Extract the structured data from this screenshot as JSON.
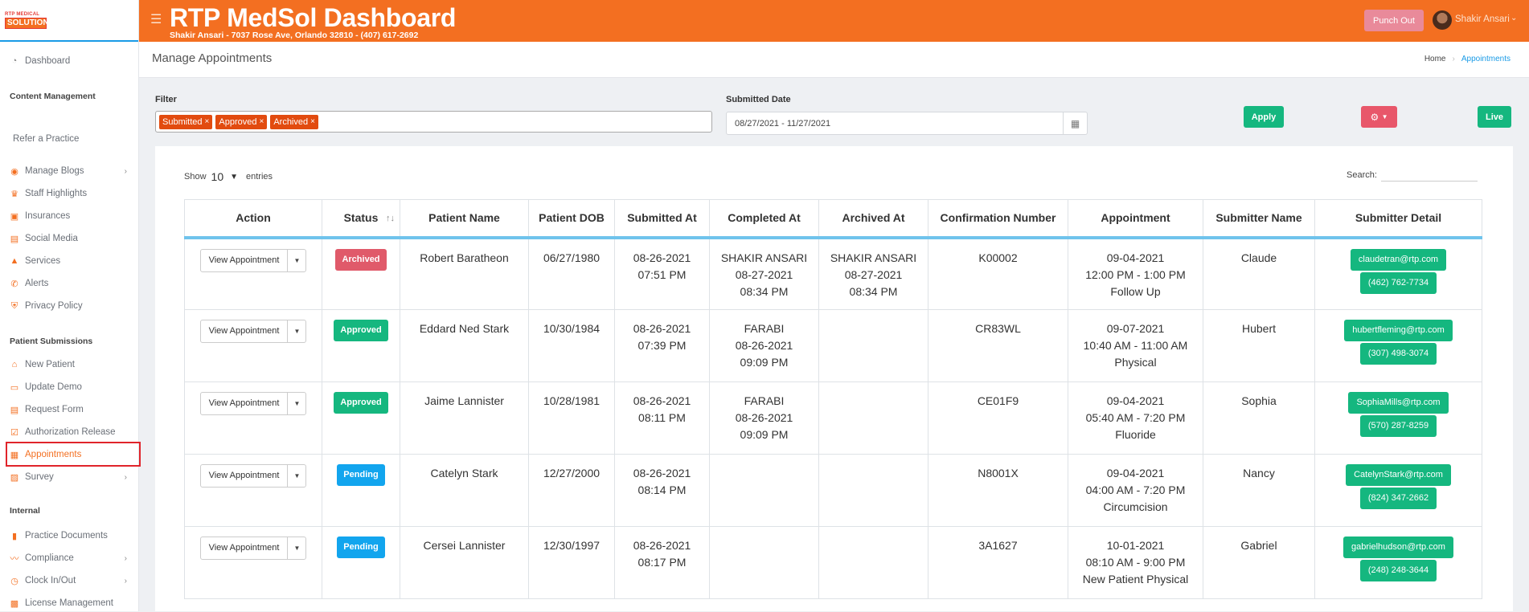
{
  "logo": {
    "line1": "RTP MEDICAL",
    "line2": "SOLUTION"
  },
  "sidebar": {
    "dashboard": "Dashboard",
    "content_management": "Content Management",
    "refer": "Refer a Practice",
    "content_items": [
      {
        "label": "Manage Blogs",
        "icon": "blog-icon",
        "chevron": true
      },
      {
        "label": "Staff Highlights",
        "icon": "award-icon",
        "chevron": false
      },
      {
        "label": "Insurances",
        "icon": "insurance-icon",
        "chevron": false
      },
      {
        "label": "Social Media",
        "icon": "social-icon",
        "chevron": false
      },
      {
        "label": "Services",
        "icon": "services-icon",
        "chevron": false
      },
      {
        "label": "Alerts",
        "icon": "phone-icon",
        "chevron": false
      },
      {
        "label": "Privacy Policy",
        "icon": "shield-icon",
        "chevron": false
      }
    ],
    "patient_submissions": "Patient Submissions",
    "patient_items": [
      {
        "label": "New Patient",
        "icon": "home-icon",
        "chevron": false
      },
      {
        "label": "Update Demo",
        "icon": "id-card-icon",
        "chevron": false
      },
      {
        "label": "Request Form",
        "icon": "form-icon",
        "chevron": false
      },
      {
        "label": "Authorization Release",
        "icon": "check-doc-icon",
        "chevron": false
      },
      {
        "label": "Appointments",
        "icon": "calendar-icon",
        "chevron": false
      },
      {
        "label": "Survey",
        "icon": "survey-icon",
        "chevron": true
      }
    ],
    "internal": "Internal",
    "internal_items": [
      {
        "label": "Practice Documents",
        "icon": "document-icon",
        "chevron": false
      },
      {
        "label": "Compliance",
        "icon": "compliance-icon",
        "chevron": true
      },
      {
        "label": "Clock In/Out",
        "icon": "clock-icon",
        "chevron": true
      },
      {
        "label": "License Management",
        "icon": "license-icon",
        "chevron": false
      }
    ]
  },
  "header": {
    "title": "RTP MedSol Dashboard",
    "subtitle": "Shakir Ansari - 7037 Rose Ave, Orlando 32810 - (407) 617-2692",
    "punch_out": "Punch Out",
    "user": "Shakir Ansari"
  },
  "page": {
    "title": "Manage Appointments",
    "breadcrumb_home": "Home",
    "breadcrumb_current": "Appointments"
  },
  "filters": {
    "filter_label": "Filter",
    "tags": [
      "Submitted",
      "Approved",
      "Archived"
    ],
    "date_label": "Submitted Date",
    "date_value": "08/27/2021 - 11/27/2021",
    "apply": "Apply",
    "live": "Live"
  },
  "table_controls": {
    "show": "Show",
    "entries_value": "10",
    "entries": "entries",
    "search": "Search:"
  },
  "table": {
    "columns": [
      "Action",
      "Status",
      "Patient Name",
      "Patient DOB",
      "Submitted At",
      "Completed At",
      "Archived At",
      "Confirmation Number",
      "Appointment",
      "Submitter Name",
      "Submitter Detail"
    ],
    "view_label": "View Appointment",
    "rows": [
      {
        "status": "Archived",
        "status_class": "b-archived",
        "name": "Robert Baratheon",
        "dob": "06/27/1980",
        "submitted": [
          "08-26-2021",
          "07:51 PM"
        ],
        "completed": [
          "SHAKIR ANSARI",
          "08-27-2021",
          "08:34 PM"
        ],
        "archived": [
          "SHAKIR ANSARI",
          "08-27-2021",
          "08:34 PM"
        ],
        "confirmation": "K00002",
        "appointment": [
          "09-04-2021",
          "12:00 PM - 1:00 PM",
          "Follow Up"
        ],
        "submitter": "Claude",
        "email": "claudetran@rtp.com",
        "phone": "(462) 762-7734"
      },
      {
        "status": "Approved",
        "status_class": "b-approved",
        "name": "Eddard Ned Stark",
        "dob": "10/30/1984",
        "submitted": [
          "08-26-2021",
          "07:39 PM"
        ],
        "completed": [
          "FARABI",
          "08-26-2021",
          "09:09 PM"
        ],
        "archived": [],
        "confirmation": "CR83WL",
        "appointment": [
          "09-07-2021",
          "10:40 AM - 11:00 AM",
          "Physical"
        ],
        "submitter": "Hubert",
        "email": "hubertfleming@rtp.com",
        "phone": "(307) 498-3074"
      },
      {
        "status": "Approved",
        "status_class": "b-approved",
        "name": "Jaime Lannister",
        "dob": "10/28/1981",
        "submitted": [
          "08-26-2021",
          "08:11 PM"
        ],
        "completed": [
          "FARABI",
          "08-26-2021",
          "09:09 PM"
        ],
        "archived": [],
        "confirmation": "CE01F9",
        "appointment": [
          "09-04-2021",
          "05:40 AM - 7:20 PM",
          "Fluoride"
        ],
        "submitter": "Sophia",
        "email": "SophiaMills@rtp.com",
        "phone": "(570) 287-8259"
      },
      {
        "status": "Pending",
        "status_class": "b-pending",
        "name": "Catelyn Stark",
        "dob": "12/27/2000",
        "submitted": [
          "08-26-2021",
          "08:14 PM"
        ],
        "completed": [],
        "archived": [],
        "confirmation": "N8001X",
        "appointment": [
          "09-04-2021",
          "04:00 AM - 7:20 PM",
          "Circumcision"
        ],
        "submitter": "Nancy",
        "email": "CatelynStark@rtp.com",
        "phone": "(824) 347-2662"
      },
      {
        "status": "Pending",
        "status_class": "b-pending",
        "name": "Cersei Lannister",
        "dob": "12/30/1997",
        "submitted": [
          "08-26-2021",
          "08:17 PM"
        ],
        "completed": [],
        "archived": [],
        "confirmation": "3A1627",
        "appointment": [
          "10-01-2021",
          "08:10 AM - 9:00 PM",
          "New Patient Physical"
        ],
        "submitter": "Gabriel",
        "email": "gabrielhudson@rtp.com",
        "phone": "(248) 248-3644"
      }
    ]
  },
  "colors": {
    "brand": "#f36f21",
    "green": "#15b77f",
    "blue": "#12a5ee",
    "red": "#e05a6a"
  }
}
